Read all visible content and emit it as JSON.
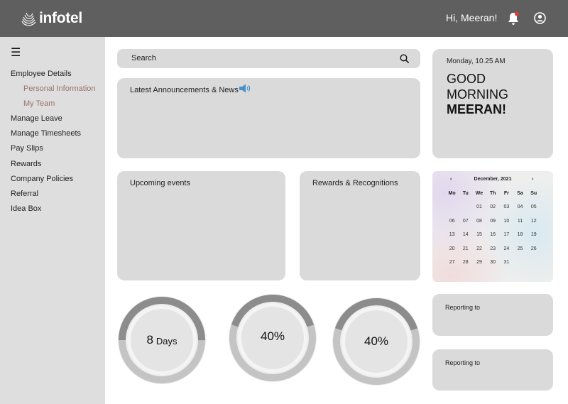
{
  "header": {
    "logo_text": "infotel",
    "greeting": "Hi, Meeran!",
    "bell_icon": "bell-icon",
    "user_icon": "user-circle-icon"
  },
  "sidebar": {
    "menu_icon": "hamburger-icon",
    "items": [
      {
        "label": "Employee Details"
      },
      {
        "label": "Personal Information"
      },
      {
        "label": "My Team"
      },
      {
        "label": "Manage Leave"
      },
      {
        "label": "Manage Timesheets"
      },
      {
        "label": "Pay Slips"
      },
      {
        "label": "Rewards"
      },
      {
        "label": "Company Policies"
      },
      {
        "label": "Referral"
      },
      {
        "label": "Idea Box"
      }
    ]
  },
  "search": {
    "label": "Search",
    "icon": "search-icon"
  },
  "news": {
    "title": "Latest Announcements & News",
    "icon": "megaphone-icon"
  },
  "events": {
    "title": "Upcoming events"
  },
  "rewards": {
    "title": "Rewards & Recognitions"
  },
  "greeting_card": {
    "datetime": "Monday, 10.25 AM",
    "line1": "GOOD",
    "line2": "MORNING",
    "name": "MEERAN!"
  },
  "calendar": {
    "month": "December, 2021",
    "prev": "‹",
    "next": "›",
    "weekdays": [
      "Mo",
      "Tu",
      "We",
      "Th",
      "Fr",
      "Sa",
      "Su"
    ],
    "days": [
      "",
      "",
      "01",
      "02",
      "03",
      "04",
      "05",
      "06",
      "07",
      "08",
      "09",
      "10",
      "11",
      "12",
      "13",
      "14",
      "15",
      "16",
      "17",
      "18",
      "19",
      "20",
      "21",
      "22",
      "23",
      "24",
      "25",
      "26",
      "27",
      "28",
      "29",
      "30",
      "31",
      "",
      ""
    ]
  },
  "stats": [
    {
      "value": "8",
      "unit": "Days",
      "progress": 0.5
    },
    {
      "value": "40%",
      "unit": "",
      "progress": 0.4
    },
    {
      "value": "40%",
      "unit": "",
      "progress": 0.4
    }
  ],
  "reporting": [
    {
      "title": "Reporting to"
    },
    {
      "title": "Reporting to"
    }
  ],
  "colors": {
    "header_bg": "#5f5f5f",
    "sidebar_bg": "#dedede",
    "card_bg": "#dadada",
    "submenu_text": "#9a7468",
    "bell_badge": "#e53935"
  }
}
